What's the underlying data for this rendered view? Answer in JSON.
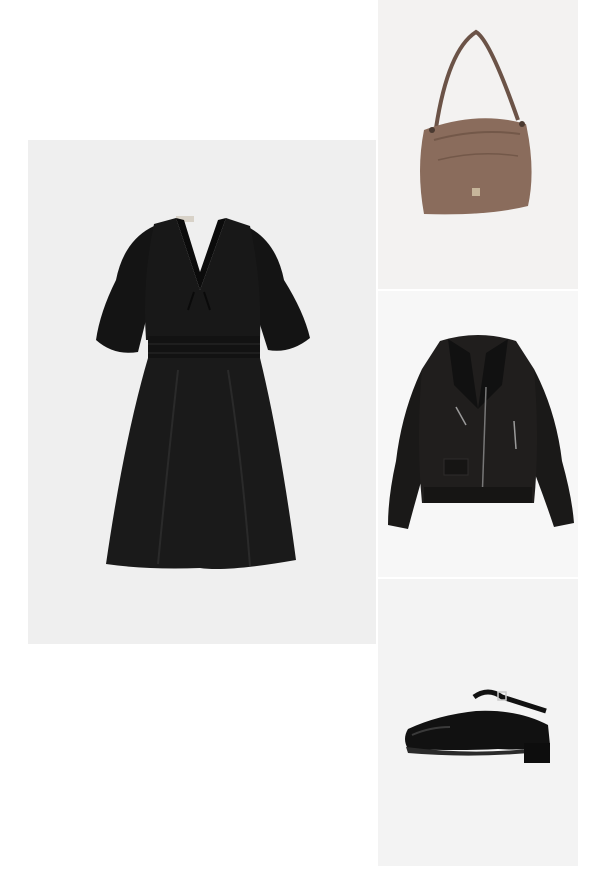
{
  "outfit": {
    "items": [
      {
        "id": "dress",
        "icon": "black-satin-dress-image",
        "background": "#efefef"
      },
      {
        "id": "bag",
        "icon": "brown-shoulder-bag-image",
        "background": "#f3f2f1"
      },
      {
        "id": "jacket",
        "icon": "black-leather-jacket-image",
        "background": "#f7f7f7"
      },
      {
        "id": "shoe",
        "icon": "black-mary-jane-shoe-image",
        "background": "#f3f3f3"
      }
    ]
  },
  "colors": {
    "page_background": "#ffffff",
    "dress": "#151515",
    "bag": "#8a6c5c",
    "jacket": "#1c1a19",
    "shoe": "#111111"
  }
}
